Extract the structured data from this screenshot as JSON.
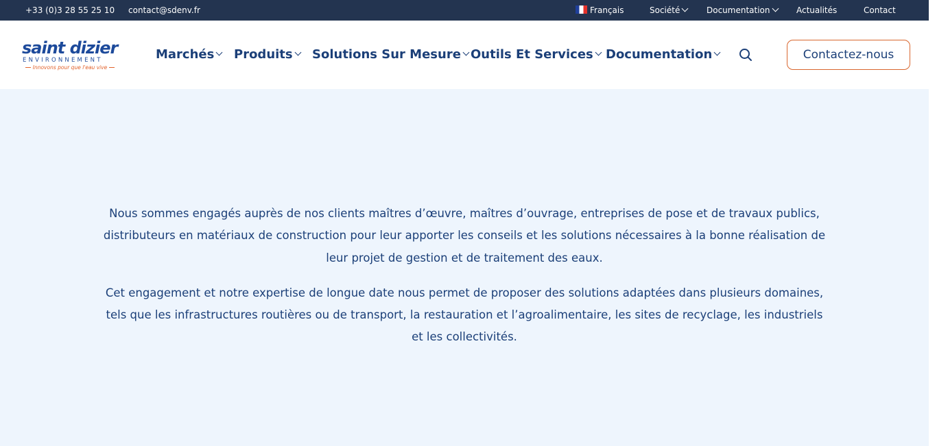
{
  "topbar": {
    "phone": "+33 (0)3 28 55 25 10",
    "email": "contact@sdenv.fr",
    "language": "Français",
    "links": {
      "societe": "Société",
      "documentation": "Documentation",
      "actualites": "Actualités",
      "contact": "Contact"
    }
  },
  "logo": {
    "name": "saint dizier",
    "subtitle": "ENVIRONNEMENT",
    "tagline": "Innovons pour que l'eau vive"
  },
  "nav": {
    "marches": "Marchés",
    "produits": "Produits",
    "solutions": "Solutions Sur Mesure",
    "outils": "Outils Et Services",
    "documentation": "Documentation"
  },
  "header": {
    "contact_button": "Contactez-nous"
  },
  "content": {
    "paragraph_1": "Nous sommes engagés auprès de nos clients maîtres d’œuvre, maîtres d’ouvrage, entreprises de pose et de travaux publics, distributeurs en matériaux de construction pour leur apporter les conseils et les solutions nécessaires à la bonne réalisation de leur projet de gestion et de traitement des eaux.",
    "paragraph_2": "Cet engagement et notre expertise de longue date nous permet de proposer des solutions adaptées dans plusieurs domaines, tels que les infrastructures routières ou de transport, la restauration et l’agroalimentaire, les sites de recyclage, les industriels et les collectivités."
  },
  "colors": {
    "topbar_bg": "#233450",
    "brand_blue": "#1b3f78",
    "accent_orange": "#d9662e",
    "content_bg": "#eef5fd"
  },
  "icons": {
    "search": "search-icon",
    "flag": "flag-fr-icon",
    "chevron": "chevron-down-icon"
  }
}
